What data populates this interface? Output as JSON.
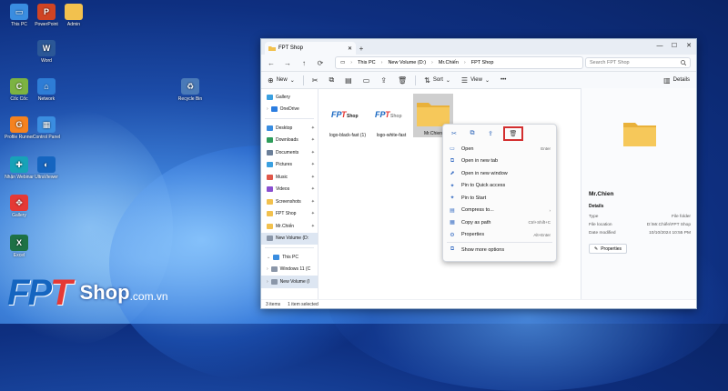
{
  "desktop": {
    "icons": [
      {
        "label": "This PC",
        "color": "#3a8de0",
        "glyph": "▭"
      },
      {
        "label": "PowerPoint",
        "color": "#d04423",
        "glyph": "P"
      },
      {
        "label": "Admin",
        "color": "#f2c14e",
        "glyph": ""
      },
      {
        "label": "Word",
        "color": "#2b5797",
        "glyph": "W"
      },
      {
        "label": "Cốc Cốc",
        "color": "#7cb342",
        "glyph": "C"
      },
      {
        "label": "Network",
        "color": "#2e7dd6",
        "glyph": "⌂"
      },
      {
        "label": "Recycle Bin",
        "color": "#4a7ab8",
        "glyph": "♻"
      },
      {
        "label": "Profile Runner",
        "color": "#f5821f",
        "glyph": "G"
      },
      {
        "label": "Control Panel",
        "color": "#3a8de0",
        "glyph": "▦"
      },
      {
        "label": "Nhận Webinar",
        "color": "#17a2b8",
        "glyph": "✚"
      },
      {
        "label": "UltraViewer",
        "color": "#1565c0",
        "glyph": "◐"
      },
      {
        "label": "Gallery",
        "color": "#e53935",
        "glyph": "✥"
      },
      {
        "label": "Excel",
        "color": "#1e7145",
        "glyph": "X"
      }
    ]
  },
  "brand": {
    "fp": "FP",
    "t": "T",
    "shop": "Shop",
    "domain": ".com.vn"
  },
  "window": {
    "tab_title": "FPT Shop",
    "tab_close": "✕",
    "tab_add": "+",
    "controls": {
      "minimize": "—",
      "maximize": "☐",
      "close": "✕"
    },
    "nav": {
      "back": "←",
      "forward": "→",
      "up": "↑",
      "refresh": "⟳",
      "monitor": "▭",
      "chevron": "›"
    },
    "breadcrumb": [
      "This PC",
      "New Volume (D:)",
      "Mr.Chiến",
      "FPT Shop"
    ],
    "search_placeholder": "Search FPT Shop",
    "toolbar": {
      "new": "New",
      "sort": "Sort",
      "view": "View",
      "more": "•••",
      "details": "Details"
    },
    "sidebar": {
      "top": [
        {
          "label": "Gallery"
        },
        {
          "label": "OneDrive"
        }
      ],
      "quick": [
        {
          "label": "Desktop",
          "color": "#3a8de0"
        },
        {
          "label": "Downloads",
          "color": "#2e9d5b"
        },
        {
          "label": "Documents",
          "color": "#6b7f99"
        },
        {
          "label": "Pictures",
          "color": "#3aa0e0"
        },
        {
          "label": "Music",
          "color": "#e0584a"
        },
        {
          "label": "Videos",
          "color": "#8a4fd0"
        },
        {
          "label": "Screenshots",
          "color": "#f2c14e"
        },
        {
          "label": "FPT Shop",
          "color": "#f2c14e"
        },
        {
          "label": "Mr.Chiến",
          "color": "#f2c14e"
        },
        {
          "label": "New Volume (D:",
          "color": "#8a96a8"
        }
      ],
      "bottom": [
        {
          "label": "This PC"
        },
        {
          "label": "Windows 11 (C"
        },
        {
          "label": "New Volume (I"
        }
      ]
    },
    "files": [
      {
        "name": "logo-black-fast (1)"
      },
      {
        "name": "logo-white-fast"
      },
      {
        "name": "Mr.Chien"
      }
    ],
    "details_pane": {
      "name": "Mr.Chien",
      "header": "Details",
      "rows": [
        {
          "key": "Type",
          "value": "File folder"
        },
        {
          "key": "File location",
          "value": "D:\\Mr.Chiến\\FPT Shop"
        },
        {
          "key": "Date modified",
          "value": "10/10/2024 10:55 PM"
        }
      ],
      "properties_btn": "Properties"
    },
    "status": {
      "count": "3 items",
      "selected": "1 item selected"
    }
  },
  "context_menu": {
    "items": [
      {
        "label": "Open",
        "shortcut": "Enter",
        "icon": "▭"
      },
      {
        "label": "Open in new tab",
        "shortcut": "",
        "icon": "⧉"
      },
      {
        "label": "Open in new window",
        "shortcut": "",
        "icon": "⬈"
      },
      {
        "label": "Pin to Quick access",
        "shortcut": "",
        "icon": "✦"
      },
      {
        "label": "Pin to Start",
        "shortcut": "",
        "icon": "✦"
      },
      {
        "label": "Compress to...",
        "shortcut": "›",
        "icon": "▤"
      },
      {
        "label": "Copy as path",
        "shortcut": "Ctrl+Shift+C",
        "icon": "▦"
      },
      {
        "label": "Properties",
        "shortcut": "Alt+Enter",
        "icon": "⚙"
      },
      {
        "label": "Show more options",
        "shortcut": "",
        "icon": "⧉"
      }
    ]
  }
}
